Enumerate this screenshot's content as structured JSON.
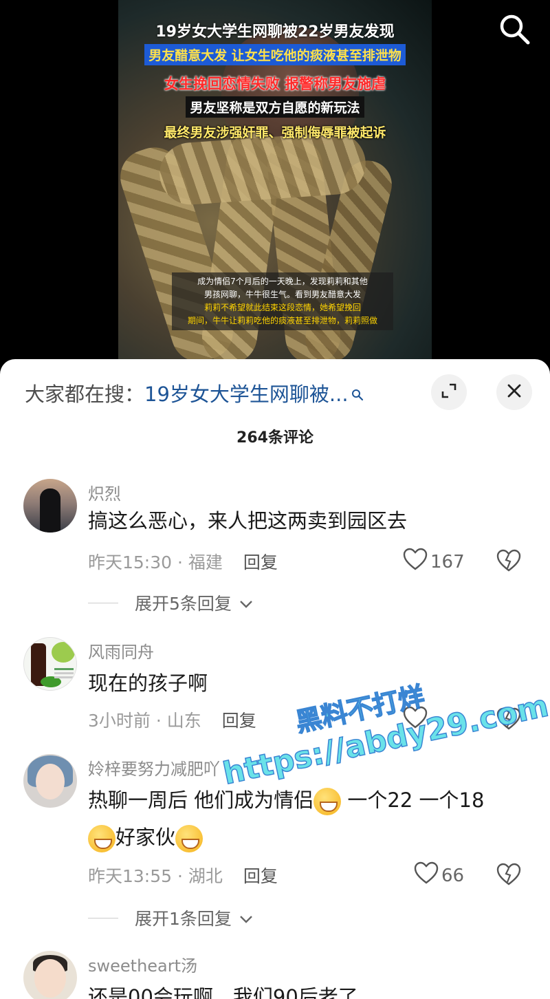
{
  "video": {
    "headline_1": "19岁女大学生网聊被22岁男友发现",
    "headline_2": "男友醋意大发 让女生吃他的痰液甚至排泄物",
    "headline_3": "女生挽回恋情失败 报警称男友施虐",
    "headline_4": "男友坚称是双方自愿的新玩法",
    "headline_5": "最终男友涉强奸罪、强制侮辱罪被起诉",
    "subtitle_1": "成为情侣7个月后的一天晚上，发现莉莉和其他",
    "subtitle_2": "男孩网聊，牛牛很生气。看到男友醋意大发",
    "subtitle_3": "莉莉不希望就此结束这段恋情，她希望挽回",
    "subtitle_4": "期间，牛牛让莉莉吃他的痰液甚至排泄物，莉莉照做"
  },
  "sheet": {
    "search_prefix": "大家都在搜：",
    "search_term": "19岁女大学生网聊被...",
    "comment_count": "264条评论"
  },
  "comments": [
    {
      "user": "炽烈",
      "text": "搞这么恶心，来人把这两卖到园区去",
      "time": "昨天15:30",
      "sep": " · ",
      "region": "福建",
      "reply": "回复",
      "likes": "167",
      "expand": "展开5条回复"
    },
    {
      "user": "风雨同舟",
      "text": "现在的孩子啊",
      "time": "3小时前",
      "sep": " · ",
      "region": "山东",
      "reply": "回复"
    },
    {
      "user": "姈梓要努力减肥吖",
      "text_1": "热聊一周后 他们成为情侣",
      "text_2": " 一个22 一个18",
      "text_3": "好家伙",
      "time": "昨天13:55",
      "sep": " · ",
      "region": "湖北",
      "reply": "回复",
      "likes": "66",
      "expand": "展开1条回复"
    },
    {
      "user": "sweetheart汤",
      "text": "还是00会玩啊，我们90后老了"
    }
  ],
  "watermark": {
    "line_1": "黑料不打烊",
    "line_2": "https://abdy29.com"
  }
}
